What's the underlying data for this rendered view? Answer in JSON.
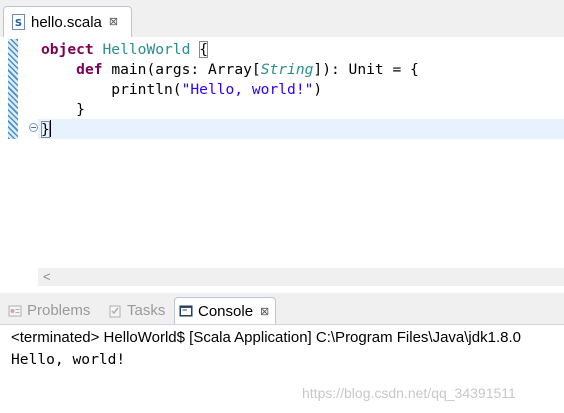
{
  "editor": {
    "tab_title": "hello.scala",
    "tab_close_glyph": "⊠",
    "file_icon": "scala-file-icon",
    "code": {
      "line1_keyword": "object",
      "line1_name": "HelloWorld",
      "line1_brace": "{",
      "line2_keyword": "def",
      "line2_sig_start": "main(args: Array[",
      "line2_type": "String",
      "line2_sig_end": "]): Unit = {",
      "line3_call": "println(",
      "line3_string": "\"Hello, world!\"",
      "line3_close": ")",
      "line4": "}",
      "line5": "}"
    },
    "scroll_left_glyph": "<"
  },
  "panel": {
    "tabs": [
      {
        "label": "Problems",
        "icon": "problems-icon"
      },
      {
        "label": "Tasks",
        "icon": "tasks-icon"
      },
      {
        "label": "Console",
        "icon": "console-icon"
      }
    ],
    "console_close_glyph": "⊠",
    "console_status": "<terminated> HelloWorld$ [Scala Application] C:\\Program Files\\Java\\jdk1.8.0",
    "console_output": "Hello, world!",
    "watermark": "https://blog.csdn.net/qq_34391511"
  },
  "colors": {
    "keyword": "#7f0055",
    "type": "#2b8e8e",
    "string": "#2a00ff",
    "current_line": "#e8f2fe"
  }
}
